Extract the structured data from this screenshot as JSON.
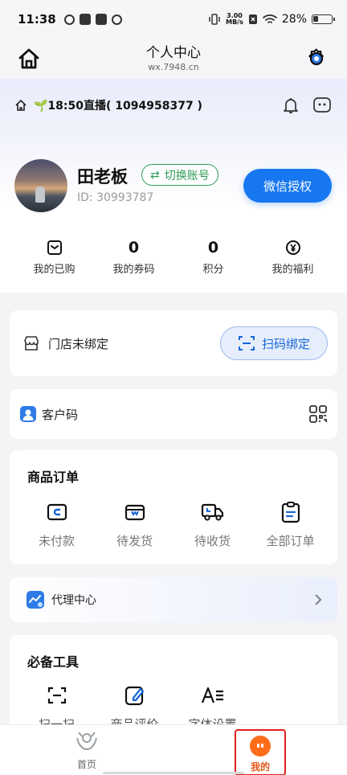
{
  "status_bar": {
    "time": "11:38",
    "net_speed_value": "3.00",
    "net_speed_unit": "MB/s",
    "battery": "28%"
  },
  "title_bar": {
    "title": "个人中心",
    "subtitle": "wx.7948.cn"
  },
  "live": {
    "text": "🌱18:50直播( 1094958377 )"
  },
  "profile": {
    "name": "田老板",
    "switch_label": "切换账号",
    "switch_icon": "⇄",
    "id_text": "ID: 30993787",
    "wechat_auth_label": "微信授权"
  },
  "stats": [
    {
      "value": "",
      "label": "我的已购",
      "icon": "purchased-icon"
    },
    {
      "value": "0",
      "label": "我的券码"
    },
    {
      "value": "0",
      "label": "积分"
    },
    {
      "value": "",
      "label": "我的福利",
      "icon": "yen-icon"
    }
  ],
  "store": {
    "label": "门店未绑定",
    "scan_bind_label": "扫码绑定"
  },
  "customer": {
    "label": "客户码"
  },
  "orders": {
    "title": "商品订单",
    "items": [
      {
        "label": "未付款",
        "icon": "wallet-icon"
      },
      {
        "label": "待发货",
        "icon": "box-icon"
      },
      {
        "label": "待收货",
        "icon": "truck-icon"
      },
      {
        "label": "全部订单",
        "icon": "clipboard-icon"
      }
    ]
  },
  "agent": {
    "label": "代理中心"
  },
  "tools": {
    "title": "必备工具",
    "items": [
      {
        "label": "扫一扫",
        "icon": "scan-icon"
      },
      {
        "label": "商品评价",
        "icon": "edit-icon"
      },
      {
        "label": "字体设置",
        "icon": "font-icon"
      }
    ]
  },
  "bottom_nav": {
    "items": [
      {
        "label": "首页",
        "icon": "home-logo-icon"
      },
      {
        "label": "我的",
        "icon": "mine-icon",
        "active": true
      }
    ]
  },
  "colors": {
    "primary_blue": "#1677f0",
    "switch_green": "#2e9c57",
    "active_orange": "#ff6d1a",
    "highlight_red": "#e01f1f"
  }
}
